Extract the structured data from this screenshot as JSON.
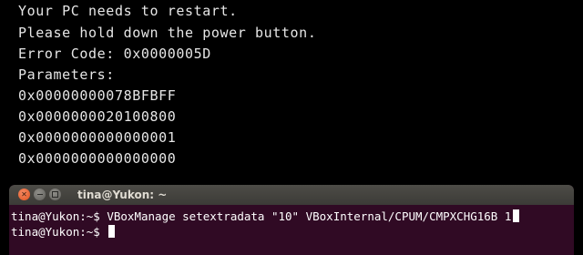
{
  "bsod": {
    "lines": [
      "Your PC needs to restart.",
      "Please hold down the power button.",
      "Error Code: 0x0000005D",
      "Parameters:",
      "0x00000000078BFBFF",
      "0x0000000020100800",
      "0x0000000000000001",
      "0x0000000000000000"
    ]
  },
  "terminal": {
    "title": "tina@Yukon: ~",
    "lines": [
      "tina@Yukon:~$ VBoxManage setextradata \"10\" VBoxInternal/CPUM/CMPXCHG16B 1",
      "tina@Yukon:~$ "
    ]
  }
}
